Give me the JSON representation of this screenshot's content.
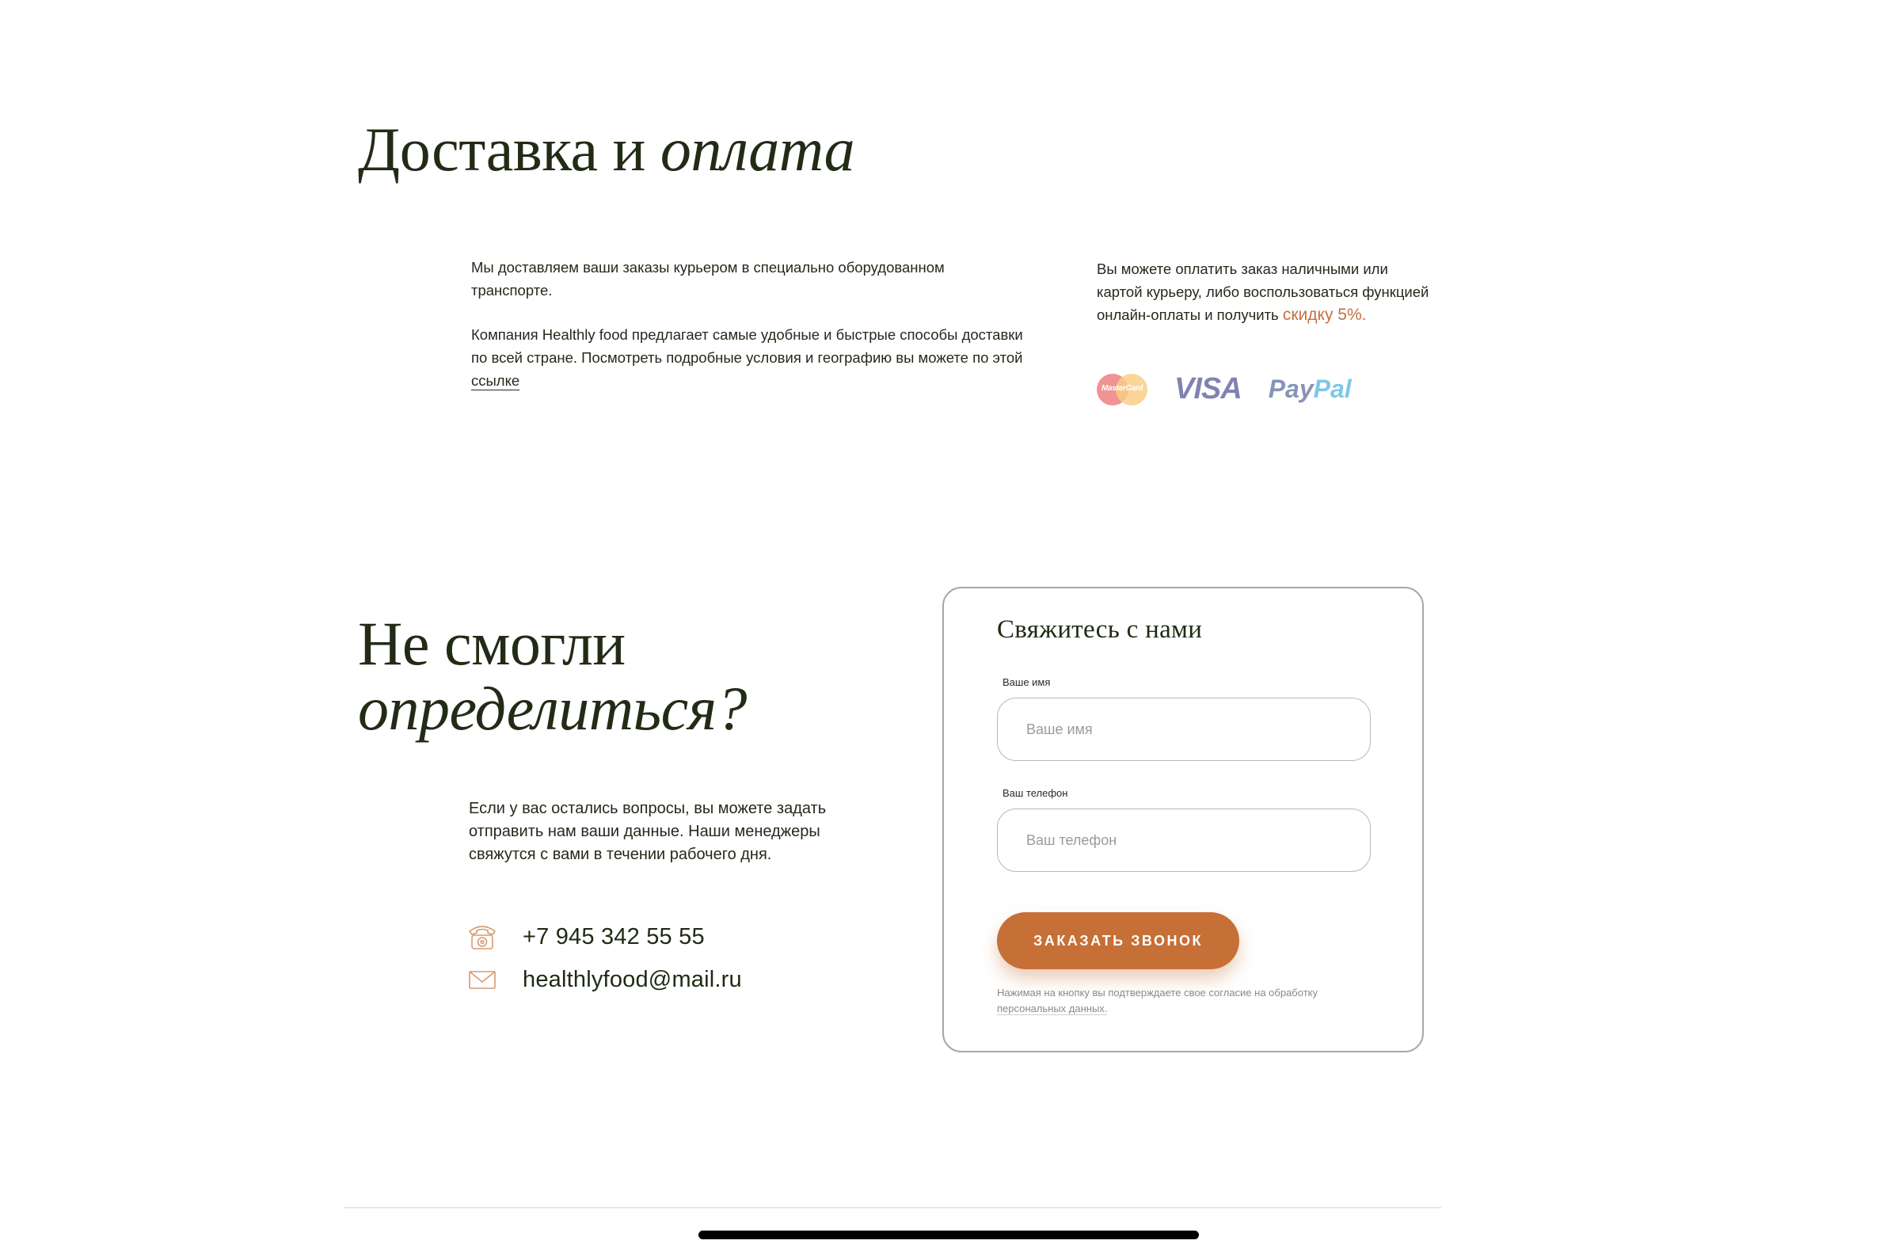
{
  "delivery": {
    "heading_plain": "Доставка и",
    "heading_italic": "оплата",
    "paragraph_1": "Мы доставляем ваши заказы курьером в специально оборудованном транспорте.",
    "paragraph_2": "Компания Healthly food предлагает самые удобные и быстрые способы доставки по всей стране. Посмотреть подробные условия и географию вы можете по этой",
    "link_text": "ссылке"
  },
  "payment": {
    "text": "Вы можете оплатить заказ наличными или картой курьеру, либо воспользоваться функцией онлайн-оплаты и получить",
    "discount": "скидку 5%.",
    "logos": {
      "mastercard": "MasterCard",
      "visa": "VISA",
      "paypal_pay": "Pay",
      "paypal_pal": "Pal"
    }
  },
  "contact_section": {
    "heading_plain": "Не смогли",
    "heading_italic": "определиться?",
    "text": "Если у вас остались вопросы, вы можете задать отправить нам ваши данные. Наши менеджеры свяжутся с вами в течении рабочего дня.",
    "phone": "+7 945 342 55 55",
    "email": "healthlyfood@mail.ru"
  },
  "form": {
    "title": "Свяжитесь с нами",
    "name_label": "Ваше имя",
    "name_placeholder": "Ваше имя",
    "phone_label": "Ваш телефон",
    "phone_placeholder": "Ваш телефон",
    "submit_label": "ЗАКАЗАТЬ ЗВОНОК",
    "consent_text": "Нажимая на кнопку вы подтверждаете свое согласие на обработку",
    "consent_link": "персональных данных."
  },
  "colors": {
    "accent": "#c66f36",
    "text_dark": "#1f2a13",
    "border": "#a7a7a7"
  },
  "icons": [
    "phone-icon",
    "mail-icon"
  ]
}
